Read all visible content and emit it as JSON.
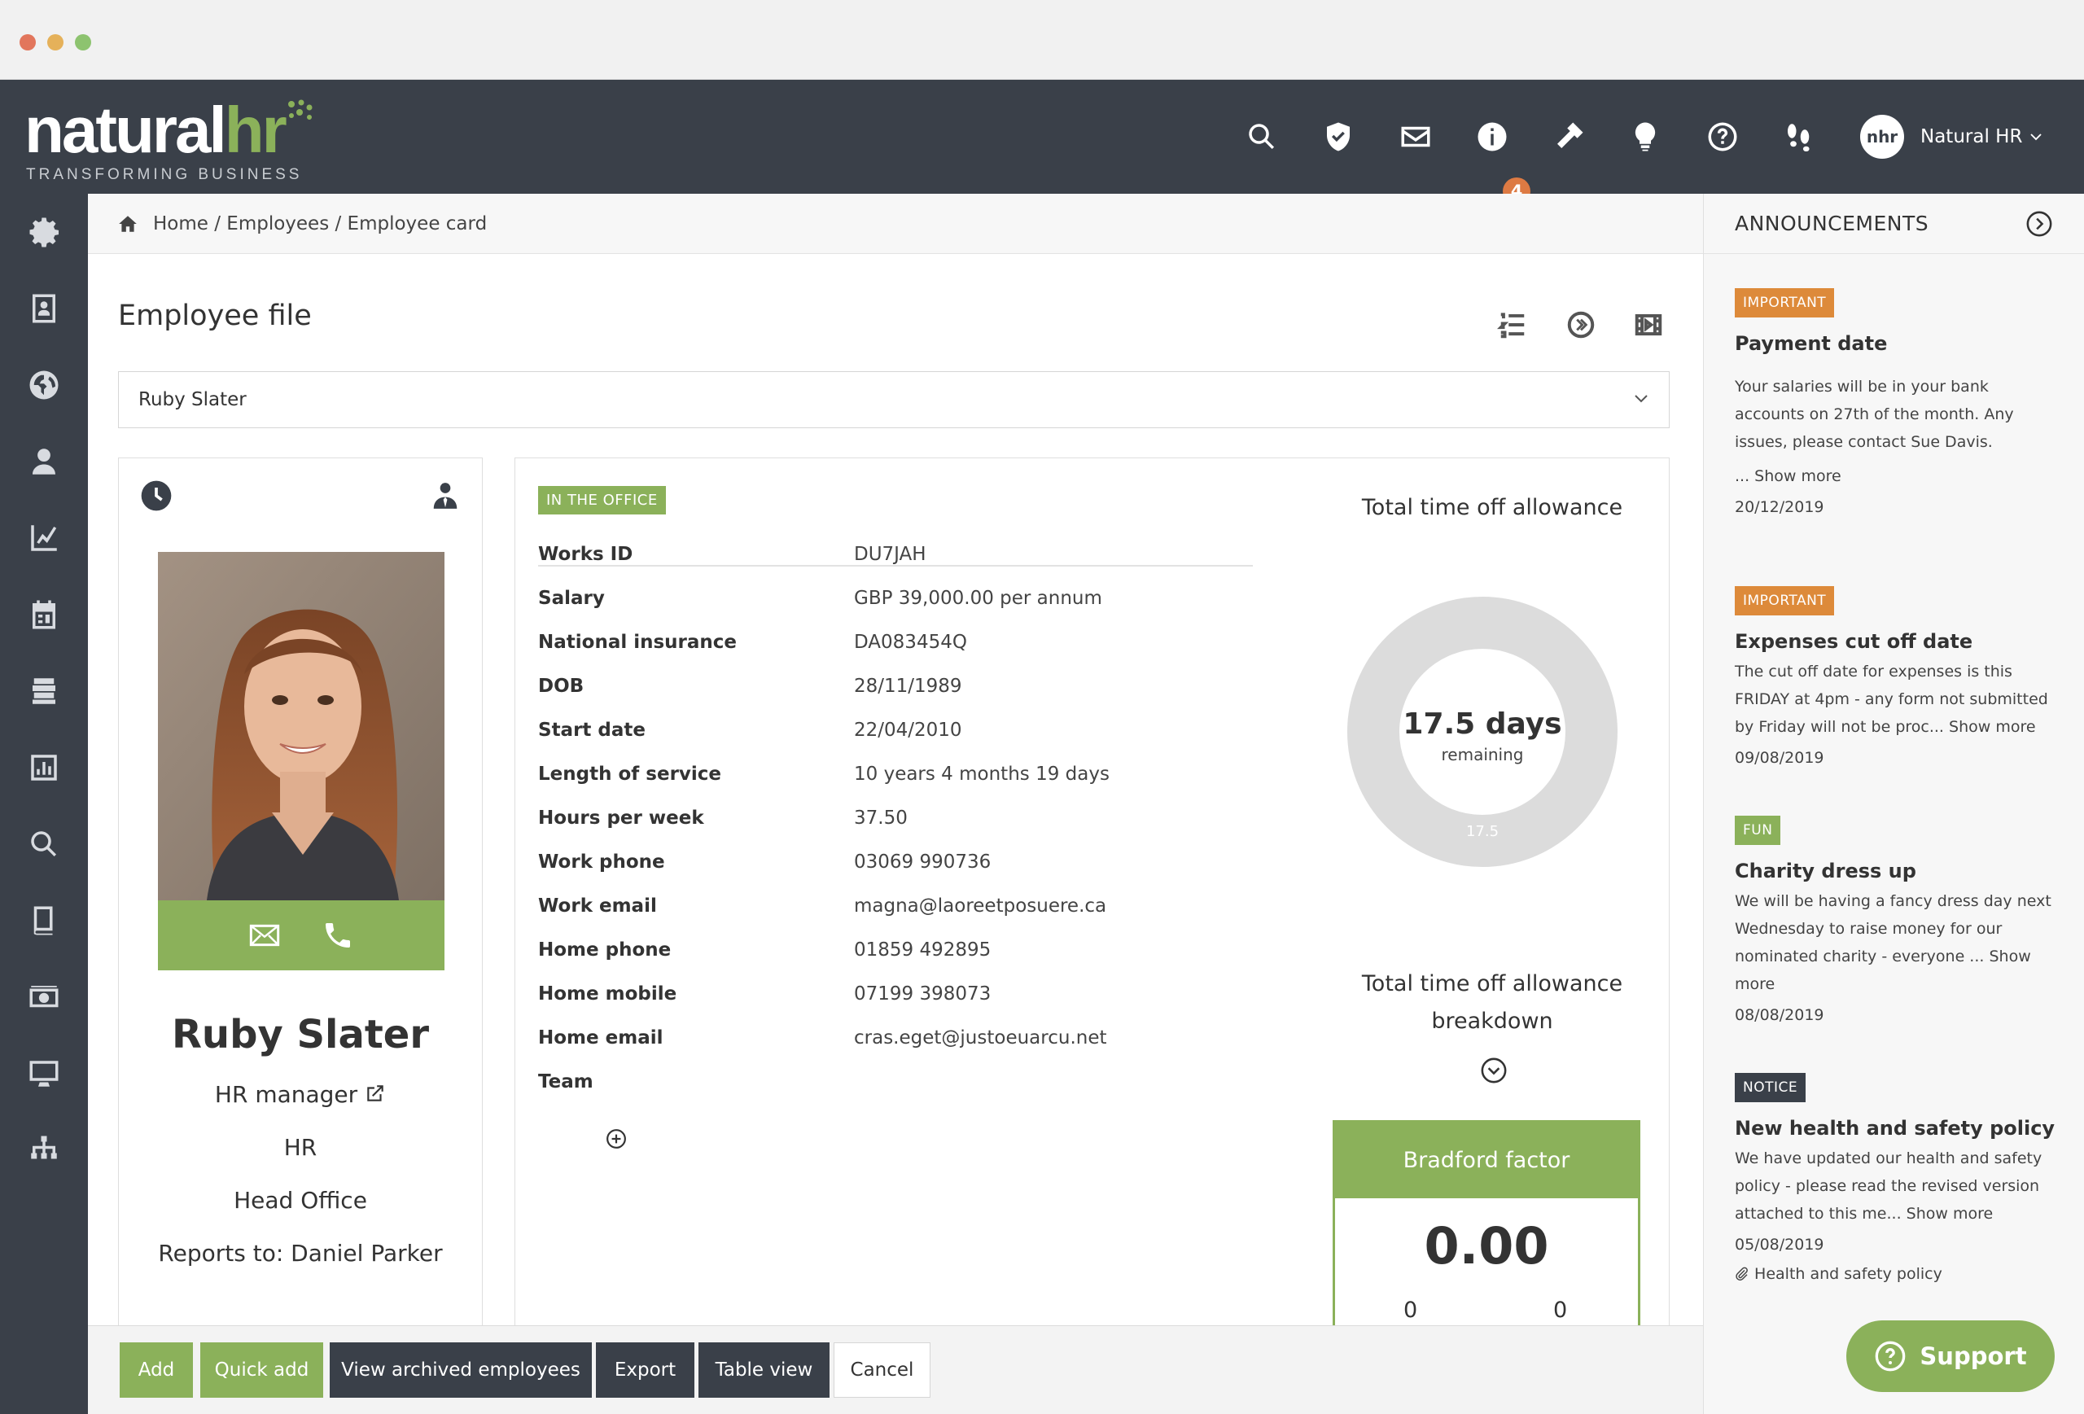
{
  "window": {
    "dots": [
      "#e2765c",
      "#e5b15a",
      "#8dc36f"
    ]
  },
  "brand": {
    "name_part1": "natural",
    "name_part2": "hr",
    "tagline": "TRANSFORMING BUSINESS"
  },
  "topbar": {
    "icons": [
      "search-icon",
      "shield-icon",
      "mail-icon",
      "info-icon",
      "wrench-icon",
      "lightbulb-icon",
      "help-icon",
      "footprints-icon"
    ],
    "notification_count": "4",
    "user": {
      "avatar_text": "nhr",
      "name": "Natural HR"
    }
  },
  "sidebar": {
    "icons": [
      "settings-icon",
      "address-book-icon",
      "globe-icon",
      "people-icon",
      "chart-icon",
      "calendar-icon",
      "building-icon",
      "report-icon",
      "search-icon",
      "book-icon",
      "money-icon",
      "monitor-icon",
      "org-chart-icon"
    ]
  },
  "breadcrumb": {
    "text": "Home / Employees / Employee card"
  },
  "page": {
    "title": "Employee file",
    "selected_employee": "Ruby Slater"
  },
  "profile": {
    "name": "Ruby Slater",
    "job_title": "HR manager",
    "department": "HR",
    "location": "Head Office",
    "reports_to": "Reports to: Daniel Parker"
  },
  "details": {
    "status_tag": "IN THE OFFICE",
    "fields": [
      {
        "label": "Works ID",
        "value": "DU7JAH"
      },
      {
        "label": "Salary",
        "value": "GBP 39,000.00 per annum"
      },
      {
        "label": "National insurance",
        "value": "DA083454Q"
      },
      {
        "label": "DOB",
        "value": "28/11/1989"
      },
      {
        "label": "Start date",
        "value": "22/04/2010"
      },
      {
        "label": "Length of service",
        "value": "10 years 4 months 19 days"
      },
      {
        "label": "Hours per week",
        "value": "37.50"
      },
      {
        "label": "Work phone",
        "value": "03069 990736"
      },
      {
        "label": "Work email",
        "value": "magna@laoreetposuere.ca"
      },
      {
        "label": "Home phone",
        "value": "01859 492895"
      },
      {
        "label": "Home mobile",
        "value": "07199 398073"
      },
      {
        "label": "Home email",
        "value": "cras.eget@justoeuarcu.net"
      },
      {
        "label": "Team",
        "value": ""
      }
    ]
  },
  "allowance": {
    "title": "Total time off allowance",
    "remaining_value": "17.5 days",
    "remaining_label": "remaining",
    "ring_label": "17.5",
    "breakdown_title_line1": "Total time off allowance",
    "breakdown_title_line2": "breakdown"
  },
  "bradford": {
    "title": "Bradford factor",
    "value": "0.00",
    "sub_left": "0",
    "sub_right": "0"
  },
  "announcements": {
    "title": "ANNOUNCEMENTS",
    "items": [
      {
        "tag": "IMPORTANT",
        "tag_color": "#dd8a3a",
        "title": "Payment date",
        "text": "Your salaries will be in your bank accounts on 27th of the month. Any issues, please contact Sue Davis.",
        "more": "... Show more",
        "date": "20/12/2019"
      },
      {
        "tag": "IMPORTANT",
        "tag_color": "#dd8a3a",
        "title": "Expenses cut off date",
        "text": "The cut off date for expenses is this FRIDAY at 4pm - any form not submitted by Friday will not be proc... Show more",
        "date": "09/08/2019"
      },
      {
        "tag": "FUN",
        "tag_color": "#8bb15a",
        "title": "Charity dress up",
        "text": "We will be having a fancy dress day next Wednesday to raise money for our nominated charity - everyone ... Show more",
        "date": "08/08/2019"
      },
      {
        "tag": "NOTICE",
        "tag_color": "#3a4049",
        "title": "New health and safety policy",
        "text": "We have updated our health and safety policy - please read the revised version attached to this me... Show more",
        "date": "05/08/2019",
        "attachment": "Health and safety policy"
      }
    ]
  },
  "actions": {
    "add": "Add",
    "quick_add": "Quick add",
    "view_archived": "View archived employees",
    "export": "Export",
    "table_view": "Table view",
    "cancel": "Cancel"
  },
  "support": {
    "label": "Support"
  },
  "colors": {
    "brand_green": "#8bb15a",
    "dark_nav": "#3a4049",
    "important_orange": "#dd8a3a",
    "badge_orange": "#dd7a43"
  }
}
